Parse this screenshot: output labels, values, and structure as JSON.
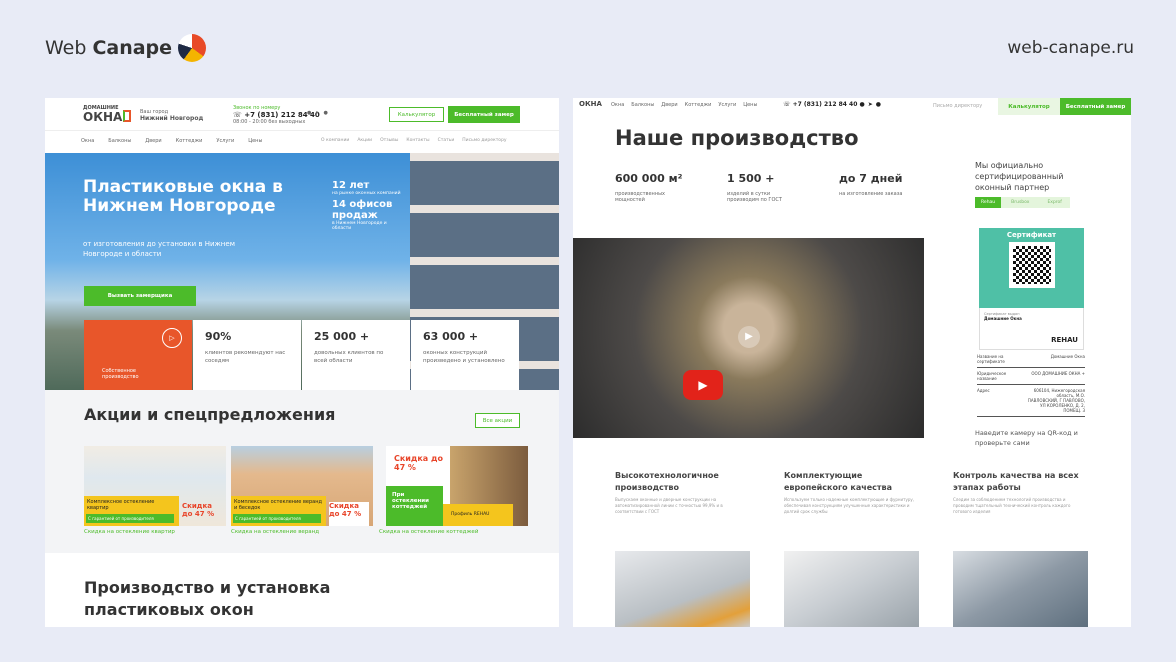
{
  "slide": {
    "brand_left": "Web",
    "brand_right": "Canape",
    "site_url": "web-canape.ru"
  },
  "left": {
    "logo_top": "ДОМАШНИЕ",
    "logo_main": "ОКНА",
    "city_label": "Ваш город",
    "city": "Нижний Новгород",
    "callback_label": "Звонок по номеру",
    "phone": "+7 (831) 212 84 40",
    "hours": "08:00 - 20:00 без выходных",
    "calc_button": "Калькулятор",
    "measure_button": "Бесплатный замер",
    "nav": [
      "Окна",
      "Балконы",
      "Двери",
      "Коттеджи",
      "Услуги",
      "Цены"
    ],
    "nav_secondary": [
      "О компании",
      "Акции",
      "Отзывы",
      "Контакты",
      "Статьи",
      "Письмо директору"
    ],
    "hero_title": "Пластиковые окна в Нижнем Новгороде",
    "hero_subtitle": "от изготовления до установки в Нижнем Новгороде и области",
    "hero_button": "Вызвать замерщика",
    "hero_facts": [
      {
        "v": "12 лет",
        "d": "на рынке оконных компаний"
      },
      {
        "v": "14 офисов продаж",
        "d": "в Нижнем Новгороде и области"
      }
    ],
    "video_card": "Собственное производство",
    "stats": [
      {
        "v": "90%",
        "d": "клиентов рекомендуют нас соседям"
      },
      {
        "v": "25 000 +",
        "d": "довольных клиентов по всей области"
      },
      {
        "v": "63 000 +",
        "d": "оконных конструкций произведено и установлено"
      }
    ],
    "promo_title": "Акции и спецпредложения",
    "promo_all": "Все акции",
    "promos": [
      {
        "label": "Комплексное остекление квартир",
        "tag": "С гарантией от производителя",
        "discount": "Скидка до 47 %",
        "caption": "Скидка на остекление квартир"
      },
      {
        "label": "Комплексное остекление веранд и беседок",
        "tag": "С гарантией от производителя",
        "discount": "Скидка до 47 %",
        "caption": "Скидка на остекление веранд"
      },
      {
        "label": "При остеклении коттеджей",
        "tag": "Профиль REHAU",
        "discount": "Скидка до 47 %",
        "caption": "Скидка на остекление коттеджей"
      }
    ],
    "production_title": "Производство и установка пластиковых окон"
  },
  "right": {
    "nav": [
      "Окна",
      "Балконы",
      "Двери",
      "Коттеджи",
      "Услуги",
      "Цены"
    ],
    "phone": "+7 (831) 212 84 40",
    "director": "Письмо директору",
    "calc_button": "Калькулятор",
    "measure_button": "Бесплатный замер",
    "title": "Наше производство",
    "stats": [
      {
        "v": "600 000 м²",
        "d": "производственных мощностей"
      },
      {
        "v": "1 500 +",
        "d": "изделий в сутки производим по ГОСТ"
      },
      {
        "v": "до 7 дней",
        "d": "на изготовление заказа"
      }
    ],
    "partner_title": "Мы официально сертифицированный оконный партнер",
    "partner_tabs": [
      "Rehau",
      "Brusbox",
      "Exprof"
    ],
    "cert": {
      "title": "Сертификат",
      "holder_label": "Сертификат выдан",
      "holder": "Домашние Окна",
      "brand": "REHAU",
      "rows": [
        {
          "k": "Название на сертификате",
          "v": "Домашние Окна"
        },
        {
          "k": "Юридическое название",
          "v": "ООО ДОМАШНИЕ ОКНА +"
        },
        {
          "k": "Адрес",
          "v": "606104, Нижегородская область, М.О. ПАВЛОВСКИЙ, Г ПАВЛОВО, УЛ КОРОЛЕНКО, Д. 2, ПОМЕЩ. 3"
        }
      ]
    },
    "qr_hint": "Наведите камеру на QR-код и проверьте сами",
    "features": [
      {
        "t": "Высокотехнологичное производство",
        "d": "Выпускаем оконные и дверные конструкции на автоматизированной линии с точностью 99,9% и в соответствии с ГОСТ"
      },
      {
        "t": "Комплектующие европейского качества",
        "d": "Используем только надежные комплектующие и фурнитуру, обеспечивая конструкциям улучшенные характеристики и долгий срок службы"
      },
      {
        "t": "Контроль качества на всех этапах работы",
        "d": "Следим за соблюдением технологий производства и проводим тщательный технический контроль каждого готового изделия"
      }
    ]
  },
  "colors": {
    "green": "#4cbb2a",
    "orange": "#e8562a",
    "teal": "#4fc0a6",
    "bg": "#e8ebf6"
  }
}
